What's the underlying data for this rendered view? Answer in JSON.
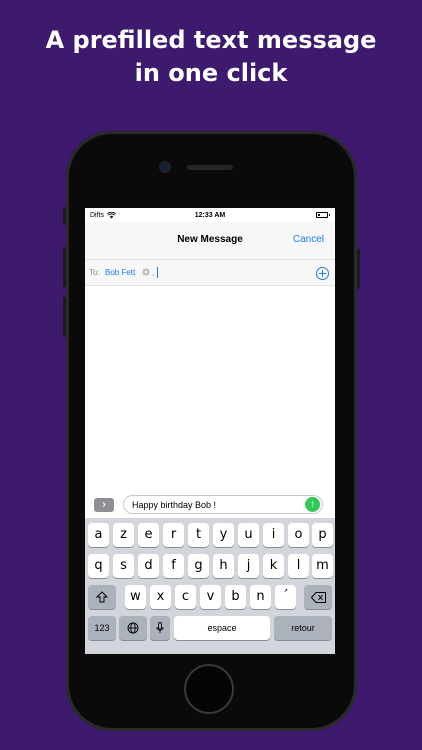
{
  "headline": {
    "line1": "A prefilled text message",
    "line2": "in one click"
  },
  "status_bar": {
    "carrier": "Difts",
    "time": "12:33 AM"
  },
  "nav": {
    "title": "New Message",
    "cancel_label": "Cancel"
  },
  "to_field": {
    "label": "To:",
    "recipient": "Bob Fett",
    "separator": ","
  },
  "compose": {
    "message_text": "Happy birthday Bob !"
  },
  "keyboard": {
    "row1": [
      "a",
      "z",
      "e",
      "r",
      "t",
      "y",
      "u",
      "i",
      "o",
      "p"
    ],
    "row2": [
      "q",
      "s",
      "d",
      "f",
      "g",
      "h",
      "j",
      "k",
      "l",
      "m"
    ],
    "row3": [
      "w",
      "x",
      "c",
      "v",
      "b",
      "n",
      "´"
    ],
    "numbers_label": "123",
    "space_label": "espace",
    "return_label": "retour"
  },
  "icons": [
    "wifi-icon",
    "battery-icon",
    "spinner-icon",
    "add-contact-icon",
    "expand-icon",
    "send-icon",
    "shift-icon",
    "backspace-icon",
    "globe-icon",
    "microphone-icon"
  ],
  "colors": {
    "background": "#3d1a6e",
    "accent": "#1a7df5",
    "send": "#34c759"
  }
}
